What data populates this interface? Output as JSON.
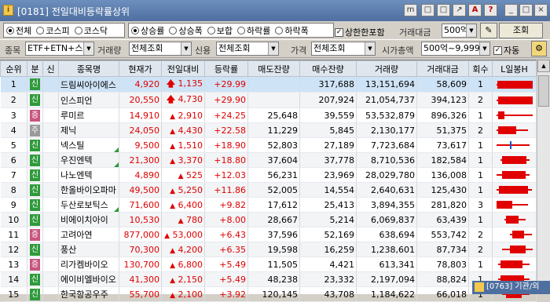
{
  "window": {
    "code": "[0181]",
    "title": "전일대비등락률상위",
    "buttons": [
      "m",
      "□",
      "□",
      "↗",
      "A",
      "?",
      "_",
      "□",
      "×"
    ]
  },
  "filters": {
    "market": {
      "options": [
        "전체",
        "코스피",
        "코스닥"
      ],
      "selected": "전체"
    },
    "direction": {
      "options": [
        "상승률",
        "상승폭",
        "보합",
        "하락률",
        "하락폭"
      ],
      "selected": "상승률"
    },
    "include_limit_label": "상한한포함",
    "include_limit_checked": true,
    "trade_value_label": "거래대금",
    "trade_value": "500억",
    "search_button": "조회",
    "item_label": "종목",
    "item_value": "ETF+ETN+스펙",
    "volume_label": "거래량",
    "volume_value": "전체조회",
    "credit_label": "신용",
    "credit_value": "전체조회",
    "price_label": "가격",
    "price_value": "전체조회",
    "mktcap_label": "시가총액",
    "mktcap_value": "500억~9,999",
    "auto_label": "자동",
    "auto_checked": true
  },
  "table": {
    "headers": [
      "순위",
      "분",
      "신",
      "종목명",
      "현재가",
      "전일대비",
      "등락률",
      "매도잔량",
      "매수잔량",
      "거래량",
      "거래대금",
      "회수",
      "L일봉H"
    ],
    "rows": [
      {
        "rank": "1",
        "type": "신",
        "type_color": "#2e9a3a",
        "flag": false,
        "name": "드림씨아이에스",
        "price": "4,920",
        "change": "1,135",
        "limit": true,
        "rate": "+29.99",
        "ask": "",
        "bid": "317,688",
        "volume": "13,151,694",
        "value": "58,609",
        "count": "1",
        "candle": {
          "lo": 0.05,
          "hi": 0.98,
          "open": 0.08,
          "close": 0.98
        }
      },
      {
        "rank": "2",
        "type": "신",
        "type_color": "#2e9a3a",
        "flag": false,
        "name": "인스피언",
        "price": "20,550",
        "change": "4,730",
        "limit": true,
        "rate": "+29.90",
        "ask": "",
        "bid": "207,924",
        "volume": "21,054,737",
        "value": "394,123",
        "count": "2",
        "candle": {
          "lo": 0.06,
          "hi": 0.98,
          "open": 0.1,
          "close": 0.98
        }
      },
      {
        "rank": "3",
        "type": "증",
        "type_color": "#c8557e",
        "flag": false,
        "name": "루미르",
        "price": "14,910",
        "change": "2,910",
        "limit": false,
        "rate": "+24.25",
        "ask": "25,648",
        "bid": "39,559",
        "volume": "53,532,879",
        "value": "896,326",
        "count": "1",
        "candle": {
          "lo": 0.05,
          "hi": 0.98,
          "open": 0.1,
          "close": 0.25
        }
      },
      {
        "rank": "4",
        "type": "주",
        "type_color": "#9a9a9a",
        "flag": false,
        "name": "제닉",
        "price": "24,050",
        "change": "4,430",
        "limit": false,
        "rate": "+22.58",
        "ask": "11,229",
        "bid": "5,845",
        "volume": "2,130,177",
        "value": "51,375",
        "count": "2",
        "candle": {
          "lo": 0.05,
          "hi": 0.85,
          "open": 0.1,
          "close": 0.55
        }
      },
      {
        "rank": "5",
        "type": "신",
        "type_color": "#2e9a3a",
        "flag": true,
        "name": "넥스틸",
        "price": "9,500",
        "change": "1,510",
        "limit": false,
        "rate": "+18.90",
        "ask": "52,803",
        "bid": "27,189",
        "volume": "7,723,684",
        "value": "73,617",
        "count": "1",
        "candle": {
          "lo": 0.05,
          "hi": 0.9,
          "open": 0.4,
          "close": 0.43
        }
      },
      {
        "rank": "6",
        "type": "신",
        "type_color": "#2e9a3a",
        "flag": true,
        "name": "우진엔텍",
        "price": "21,300",
        "change": "3,370",
        "limit": false,
        "rate": "+18.80",
        "ask": "37,604",
        "bid": "37,778",
        "volume": "8,710,536",
        "value": "182,584",
        "count": "1",
        "candle": {
          "lo": 0.15,
          "hi": 0.9,
          "open": 0.2,
          "close": 0.82
        }
      },
      {
        "rank": "7",
        "type": "신",
        "type_color": "#2e9a3a",
        "flag": false,
        "name": "나노엔텍",
        "price": "4,890",
        "change": "525",
        "limit": false,
        "rate": "+12.03",
        "ask": "56,231",
        "bid": "23,969",
        "volume": "28,029,780",
        "value": "136,008",
        "count": "1",
        "candle": {
          "lo": 0.05,
          "hi": 0.9,
          "open": 0.2,
          "close": 0.8
        }
      },
      {
        "rank": "8",
        "type": "신",
        "type_color": "#2e9a3a",
        "flag": false,
        "name": "한올바이오파마",
        "price": "49,500",
        "change": "5,250",
        "limit": false,
        "rate": "+11.86",
        "ask": "52,005",
        "bid": "14,554",
        "volume": "2,640,631",
        "value": "125,430",
        "count": "1",
        "candle": {
          "lo": 0.05,
          "hi": 0.95,
          "open": 0.12,
          "close": 0.85
        }
      },
      {
        "rank": "9",
        "type": "신",
        "type_color": "#2e9a3a",
        "flag": true,
        "name": "두산로보틱스",
        "price": "71,600",
        "change": "6,400",
        "limit": false,
        "rate": "+9.82",
        "ask": "17,612",
        "bid": "25,413",
        "volume": "3,894,355",
        "value": "281,820",
        "count": "3",
        "candle": {
          "lo": 0.05,
          "hi": 0.85,
          "open": 0.05,
          "close": 0.45
        }
      },
      {
        "rank": "10",
        "type": "신",
        "type_color": "#2e9a3a",
        "flag": false,
        "name": "비에이치아이",
        "price": "10,530",
        "change": "780",
        "limit": false,
        "rate": "+8.00",
        "ask": "28,667",
        "bid": "5,214",
        "volume": "6,069,837",
        "value": "63,439",
        "count": "1",
        "candle": {
          "lo": 0.25,
          "hi": 0.8,
          "open": 0.3,
          "close": 0.62
        }
      },
      {
        "rank": "11",
        "type": "증",
        "type_color": "#c8557e",
        "flag": false,
        "name": "고려아연",
        "price": "877,000",
        "change": "53,000",
        "limit": false,
        "rate": "+6.43",
        "ask": "37,596",
        "bid": "52,169",
        "volume": "638,694",
        "value": "553,742",
        "count": "2",
        "candle": {
          "lo": 0.4,
          "hi": 0.95,
          "open": 0.45,
          "close": 0.75
        }
      },
      {
        "rank": "12",
        "type": "신",
        "type_color": "#2e9a3a",
        "flag": false,
        "name": "풍산",
        "price": "70,300",
        "change": "4,200",
        "limit": false,
        "rate": "+6.35",
        "ask": "19,598",
        "bid": "16,259",
        "volume": "1,238,601",
        "value": "87,734",
        "count": "2",
        "candle": {
          "lo": 0.2,
          "hi": 0.98,
          "open": 0.4,
          "close": 0.8
        }
      },
      {
        "rank": "13",
        "type": "증",
        "type_color": "#c8557e",
        "flag": false,
        "name": "리가켐바이오",
        "price": "130,700",
        "change": "6,800",
        "limit": false,
        "rate": "+5.49",
        "ask": "11,505",
        "bid": "4,421",
        "volume": "613,341",
        "value": "78,803",
        "count": "1",
        "candle": {
          "lo": 0.1,
          "hi": 0.9,
          "open": 0.15,
          "close": 0.72
        }
      },
      {
        "rank": "14",
        "type": "신",
        "type_color": "#2e9a3a",
        "flag": false,
        "name": "에이비엘바이오",
        "price": "41,300",
        "change": "2,150",
        "limit": false,
        "rate": "+5.49",
        "ask": "48,238",
        "bid": "23,332",
        "volume": "2,197,094",
        "value": "88,824",
        "count": "1",
        "candle": {
          "lo": 0.1,
          "hi": 0.9,
          "open": 0.15,
          "close": 0.75
        }
      },
      {
        "rank": "15",
        "type": "신",
        "type_color": "#2e9a3a",
        "flag": false,
        "name": "한국항공우주",
        "price": "55,700",
        "change": "2,100",
        "limit": false,
        "rate": "+3.92",
        "ask": "120,145",
        "bid": "43,708",
        "volume": "1,184,622",
        "value": "66,018",
        "count": "1",
        "candle": {
          "lo": 0.2,
          "hi": 0.9,
          "open": 0.3,
          "close": 0.7
        }
      }
    ]
  },
  "popup": {
    "text": "[0763] 기관/외"
  }
}
